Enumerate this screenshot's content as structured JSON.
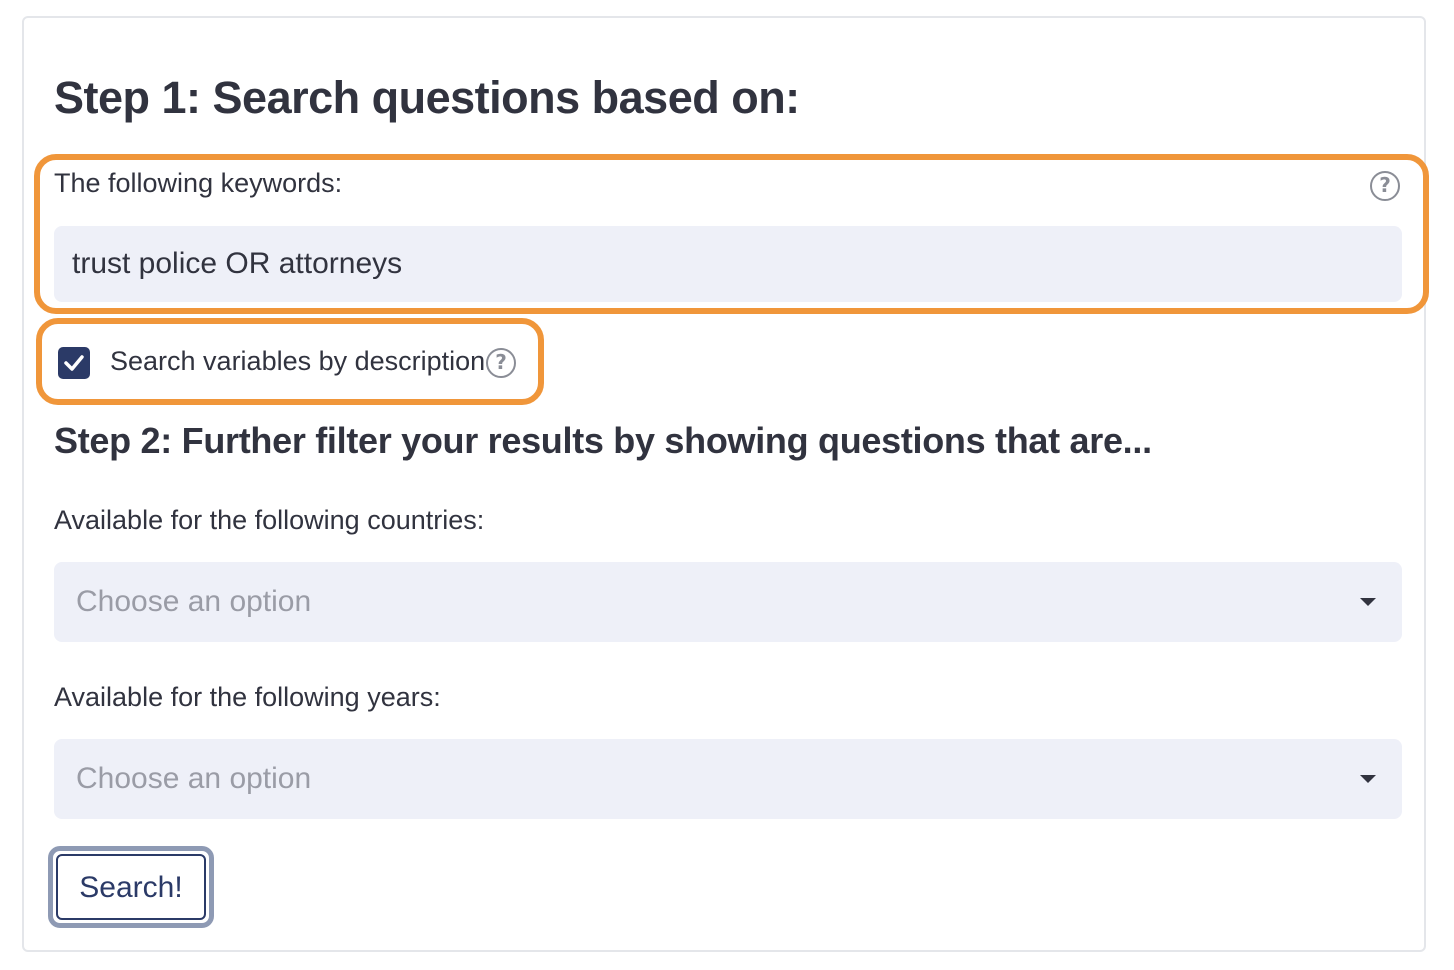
{
  "step1": {
    "title": "Step 1: Search questions based on:",
    "keywords_label": "The following keywords:",
    "keywords_value": "trust police OR attorneys",
    "search_by_description_label": "Search variables by description",
    "search_by_description_checked": true
  },
  "step2": {
    "title": "Step 2: Further filter your results by showing questions that are...",
    "countries_label": "Available for the following countries:",
    "countries_placeholder": "Choose an option",
    "years_label": "Available for the following years:",
    "years_placeholder": "Choose an option"
  },
  "search_button": {
    "label": "Search!"
  },
  "icons": {
    "help": "help-circle-icon",
    "checkmark": "checkmark-icon",
    "dropdown": "chevron-down-icon"
  },
  "colors": {
    "highlight": "#f0963a",
    "accent": "#2b3a67",
    "input_background": "#eef0f8",
    "text": "#31333f",
    "placeholder": "#9a9ca6"
  }
}
